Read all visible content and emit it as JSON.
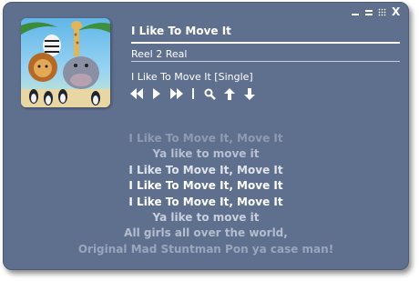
{
  "track": {
    "title": "I Like To Move It",
    "artist": "Reel 2 Real",
    "album": "I Like To Move It [Single]"
  },
  "window_controls": [
    "minimize-icon",
    "restore-icon",
    "grid-icon",
    "close-icon"
  ],
  "window_close_glyph": "X",
  "player_controls": [
    "previous-icon",
    "play-icon",
    "next-icon",
    "search-icon",
    "thumb-up-icon",
    "thumb-down-icon"
  ],
  "lyrics": [
    {
      "text": "I Like To Move It, Move It",
      "color": "#8e9bb3"
    },
    {
      "text": "Ya like to move it",
      "color": "#b7c0d1"
    },
    {
      "text": "I Like To Move It, Move It",
      "color": "#dfe4ec"
    },
    {
      "text": "I Like To Move It, Move It",
      "color": "#ffffff"
    },
    {
      "text": "I Like To Move It, Move It",
      "color": "#ffffff"
    },
    {
      "text": "Ya like to move it",
      "color": "#c9d0dd"
    },
    {
      "text": "All girls all over the world,",
      "color": "#b4bdcd"
    },
    {
      "text": "Original Mad Stuntman Pon ya case man!",
      "color": "#9aa6bc"
    }
  ],
  "colors": {
    "window_bg": "#5f6f8e",
    "text": "#ffffff"
  }
}
